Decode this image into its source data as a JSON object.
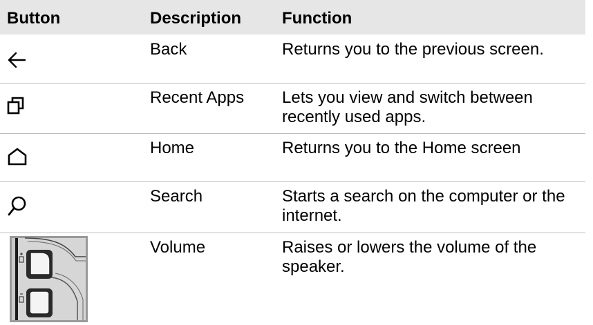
{
  "table": {
    "headers": {
      "button": "Button",
      "description": "Description",
      "function": "Function"
    },
    "rows": [
      {
        "icon": "back-arrow-icon",
        "description": "Back",
        "function": "Returns you to the previous screen."
      },
      {
        "icon": "recent-apps-icon",
        "description": "Recent Apps",
        "function": "Lets you view and switch between recently used apps."
      },
      {
        "icon": "home-icon",
        "description": "Home",
        "function": "Returns you to the Home screen"
      },
      {
        "icon": "search-icon",
        "description": "Search",
        "function": "Starts a search on the computer or the internet."
      },
      {
        "icon": "volume-buttons-image",
        "description": "Volume",
        "function": "Raises or lowers the volume of the speaker."
      }
    ]
  }
}
